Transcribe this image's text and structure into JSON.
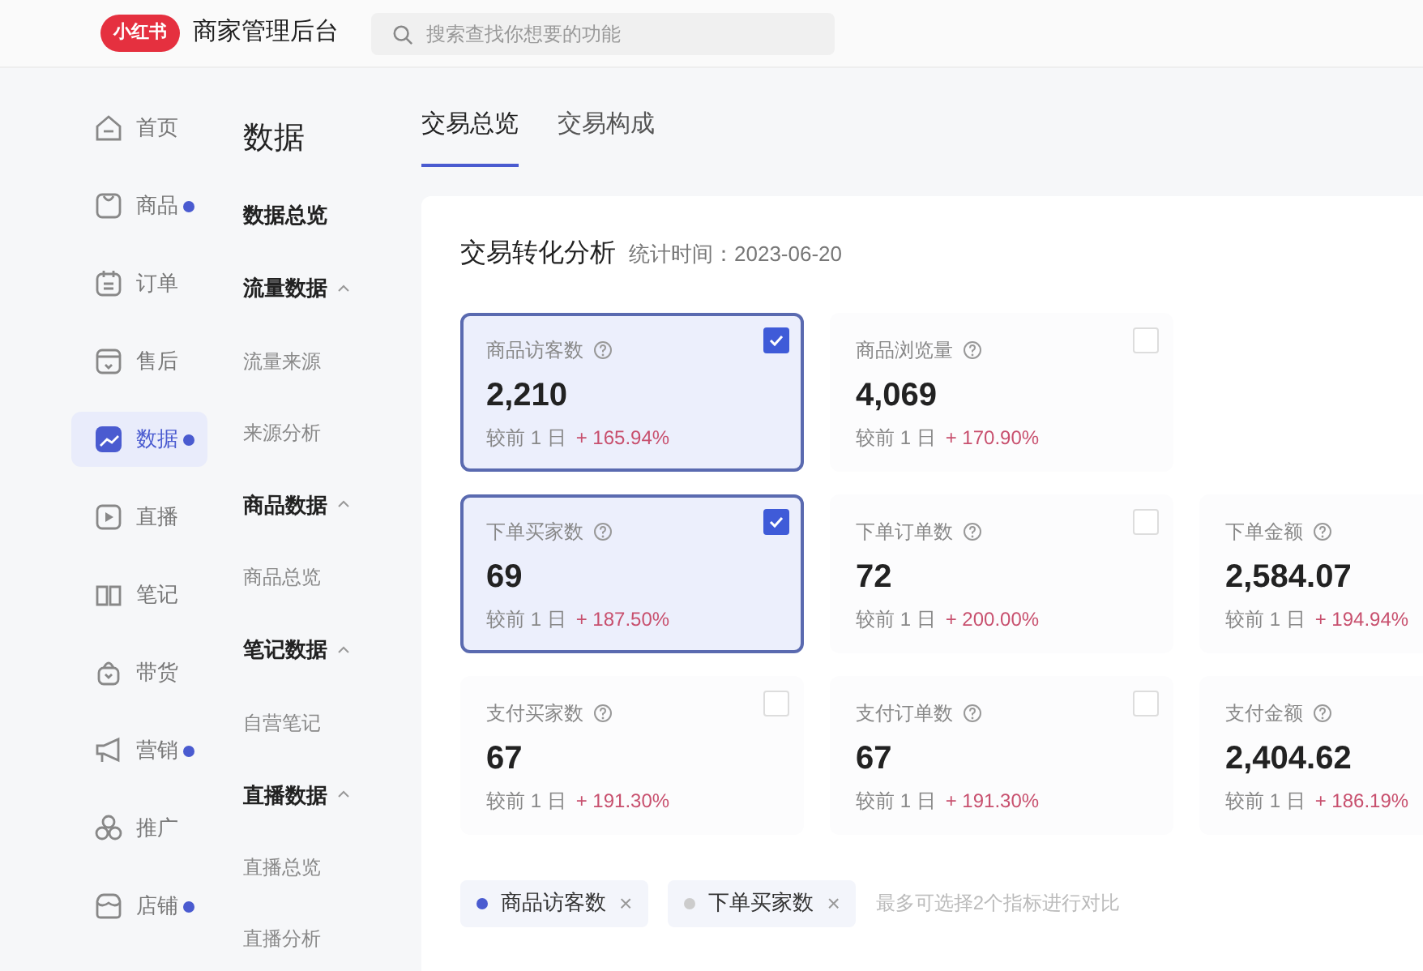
{
  "header": {
    "logo": "小红书",
    "title": "商家管理后台",
    "search": {
      "placeholder": "搜索查找你想要的功能"
    }
  },
  "nav": [
    {
      "label": "首页",
      "dot": false,
      "selected": false
    },
    {
      "label": "商品",
      "dot": true,
      "selected": false
    },
    {
      "label": "订单",
      "dot": false,
      "selected": false
    },
    {
      "label": "售后",
      "dot": false,
      "selected": false
    },
    {
      "label": "数据",
      "dot": true,
      "selected": true
    },
    {
      "label": "直播",
      "dot": false,
      "selected": false
    },
    {
      "label": "笔记",
      "dot": false,
      "selected": false
    },
    {
      "label": "带货",
      "dot": false,
      "selected": false
    },
    {
      "label": "营销",
      "dot": true,
      "selected": false
    },
    {
      "label": "推广",
      "dot": false,
      "selected": false
    },
    {
      "label": "店铺",
      "dot": true,
      "selected": false
    }
  ],
  "submenu": {
    "title": "数据",
    "items": [
      {
        "label": "数据总览"
      },
      {
        "label": "流量数据",
        "expanded": true,
        "children": [
          {
            "label": "流量来源"
          },
          {
            "label": "来源分析"
          }
        ]
      },
      {
        "label": "商品数据",
        "expanded": true,
        "children": [
          {
            "label": "商品总览"
          }
        ]
      },
      {
        "label": "笔记数据",
        "expanded": true,
        "children": [
          {
            "label": "自营笔记"
          }
        ]
      },
      {
        "label": "直播数据",
        "expanded": true,
        "children": [
          {
            "label": "直播总览"
          },
          {
            "label": "直播分析"
          }
        ]
      }
    ]
  },
  "tabs": [
    {
      "label": "交易总览",
      "selected": true
    },
    {
      "label": "交易构成",
      "selected": false
    }
  ],
  "panel": {
    "title": "交易转化分析",
    "stat_time": "统计时间：2023-06-20",
    "rows": [
      [
        {
          "label": "商品访客数",
          "value": "2,210",
          "compare": "较前 1 日",
          "change": "+ 165.94%",
          "checked": true
        },
        {
          "label": "商品浏览量",
          "value": "4,069",
          "compare": "较前 1 日",
          "change": "+ 170.90%",
          "checked": false
        }
      ],
      [
        {
          "label": "下单买家数",
          "value": "69",
          "compare": "较前 1 日",
          "change": "+ 187.50%",
          "checked": true
        },
        {
          "label": "下单订单数",
          "value": "72",
          "compare": "较前 1 日",
          "change": "+ 200.00%",
          "checked": false
        },
        {
          "label": "下单金额",
          "value": "2,584.07",
          "compare": "较前 1 日",
          "change": "+ 194.94%"
        }
      ],
      [
        {
          "label": "支付买家数",
          "value": "67",
          "compare": "较前 1 日",
          "change": "+ 191.30%",
          "checked": false
        },
        {
          "label": "支付订单数",
          "value": "67",
          "compare": "较前 1 日",
          "change": "+ 191.30%",
          "checked": false
        },
        {
          "label": "支付金额",
          "value": "2,404.62",
          "compare": "较前 1 日",
          "change": "+ 186.19%"
        }
      ]
    ],
    "chips": [
      {
        "label": "商品访客数",
        "color": "#4a5bd0",
        "remove": "×"
      },
      {
        "label": "下单买家数",
        "color": "#cccccc",
        "remove": "×"
      }
    ],
    "hint": "最多可选择2个指标进行对比"
  }
}
